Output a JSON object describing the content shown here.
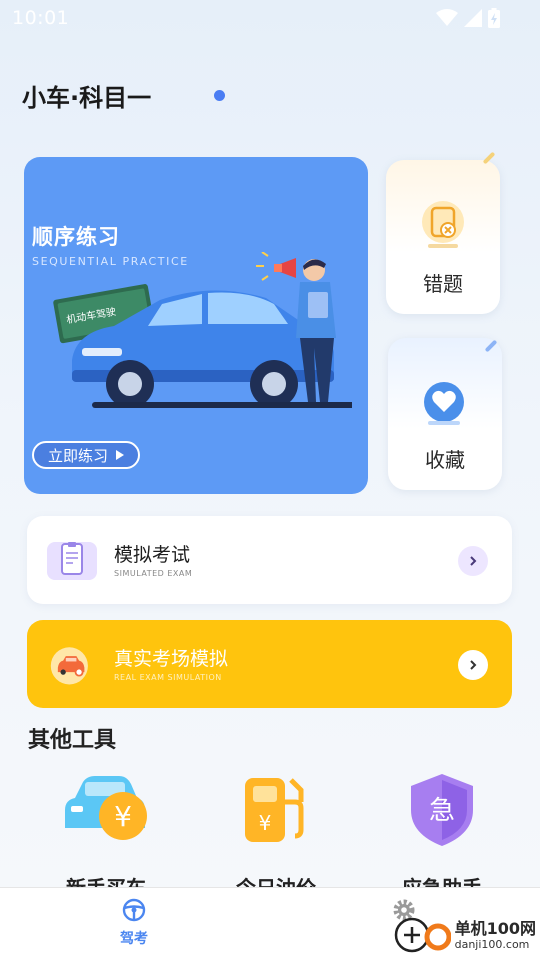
{
  "status_bar": {
    "time": "10:01"
  },
  "header": {
    "title": "小车·科目一"
  },
  "practice": {
    "title": "顺序练习",
    "subtitle": "SEQUENTIAL PRACTICE",
    "board_text": "机动车驾驶",
    "button_label": "立即练习"
  },
  "side_cards": {
    "wrong": {
      "label": "错题"
    },
    "favorite": {
      "label": "收藏"
    }
  },
  "exam_row": {
    "title": "模拟考试",
    "subtitle": "SIMULATED EXAM"
  },
  "real_row": {
    "title": "真实考场模拟",
    "subtitle": "REAL EXAM SIMULATION"
  },
  "tools": {
    "title": "其他工具",
    "items": [
      {
        "label": "新手买车",
        "icon": "car-yuan-icon"
      },
      {
        "label": "今日油价",
        "icon": "fuel-pump-icon"
      },
      {
        "label": "应急助手",
        "icon": "emergency-shield-icon"
      }
    ]
  },
  "bottom_nav": {
    "items": [
      {
        "label": "驾考",
        "icon": "steering-wheel-icon",
        "active": true
      },
      {
        "label": "",
        "icon": "gear-icon",
        "active": false
      }
    ]
  },
  "watermark": {
    "name": "单机100网",
    "url": "danji100.com"
  },
  "colors": {
    "primary_blue": "#5d9af5",
    "yellow": "#ffc40d",
    "nav_active": "#4b86f0"
  }
}
